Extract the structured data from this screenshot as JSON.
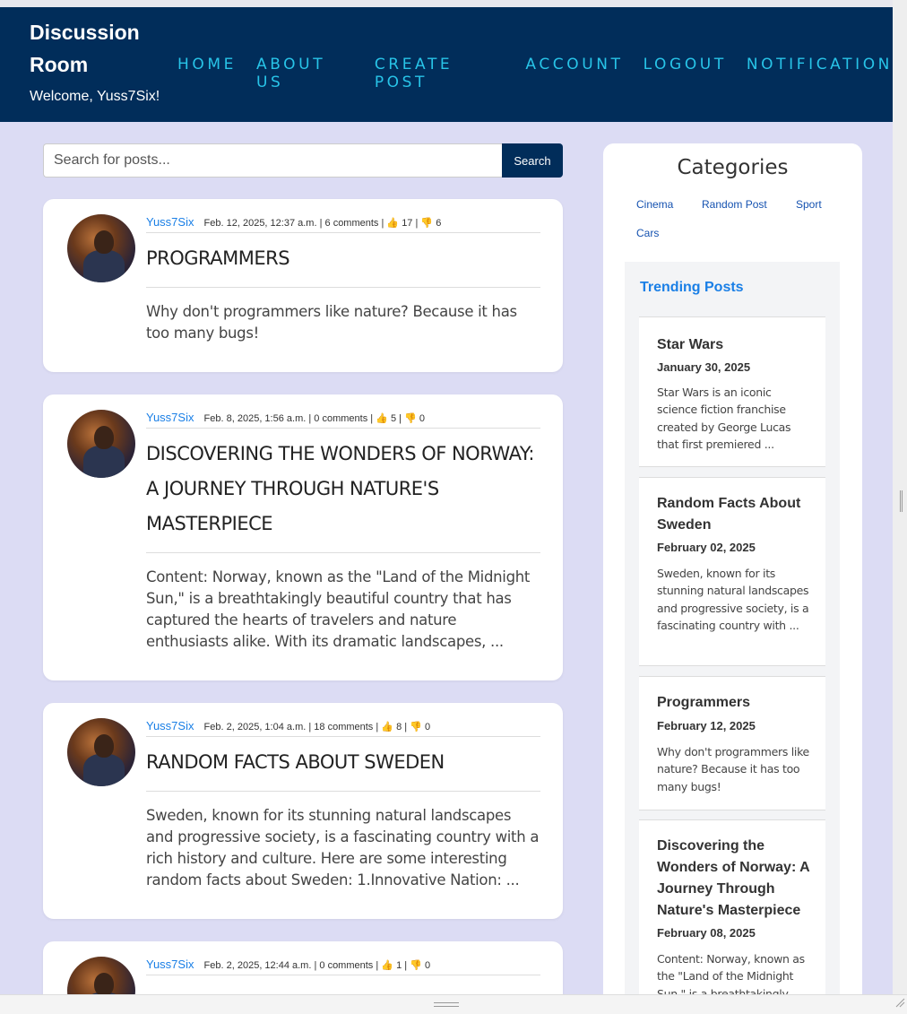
{
  "brand": {
    "line1": "Discussion",
    "line2": "Room",
    "welcome": "Welcome, Yuss7Six!"
  },
  "nav": [
    "HOME",
    "ABOUT US",
    "CREATE POST",
    "ACCOUNT",
    "LOGOUT",
    "NOTIFICATION"
  ],
  "search": {
    "placeholder": "Search for posts...",
    "value": "",
    "button": "Search"
  },
  "posts": [
    {
      "author": "Yuss7Six",
      "date": "Feb. 12, 2025, 12:37 a.m.",
      "comments": "6 comments",
      "likes": "17",
      "dislikes": "6",
      "title": "PROGRAMMERS",
      "excerpt": "Why don't programmers like nature? Because it has too many bugs!"
    },
    {
      "author": "Yuss7Six",
      "date": "Feb. 8, 2025, 1:56 a.m.",
      "comments": "0 comments",
      "likes": "5",
      "dislikes": "0",
      "title": "DISCOVERING THE WONDERS OF NORWAY: A JOURNEY THROUGH NATURE'S MASTERPIECE",
      "excerpt": "Content: Norway, known as the \"Land of the Midnight Sun,\" is a breathtakingly beautiful country that has captured the hearts of travelers and nature enthusiasts alike. With its dramatic landscapes, ..."
    },
    {
      "author": "Yuss7Six",
      "date": "Feb. 2, 2025, 1:04 a.m.",
      "comments": "18 comments",
      "likes": "8",
      "dislikes": "0",
      "title": "RANDOM FACTS ABOUT SWEDEN",
      "excerpt": "Sweden, known for its stunning natural landscapes and progressive society, is a fascinating country with a rich history and culture. Here are some interesting random facts about Sweden: 1.Innovative Nation: ..."
    },
    {
      "author": "Yuss7Six",
      "date": "Feb. 2, 2025, 12:44 a.m.",
      "comments": "0 comments",
      "likes": "1",
      "dislikes": "0",
      "title": "",
      "excerpt": ""
    }
  ],
  "sidebar": {
    "categories_title": "Categories",
    "categories": [
      "Cinema",
      "Random Post",
      "Sport",
      "Cars"
    ],
    "trending_title": "Trending Posts",
    "trending": [
      {
        "title": "Star Wars",
        "date": "January 30, 2025",
        "excerpt": "Star Wars is an iconic science fiction franchise created by George Lucas that first premiered ..."
      },
      {
        "title": "Random Facts About Sweden",
        "date": "February 02, 2025",
        "excerpt": "Sweden, known for its stunning natural landscapes and progressive society, is a fascinating country with ..."
      },
      {
        "title": "Programmers",
        "date": "February 12, 2025",
        "excerpt": "Why don't programmers like nature? Because it has too many bugs!"
      },
      {
        "title": "Discovering the Wonders of Norway: A Journey Through Nature's Masterpiece",
        "date": "February 08, 2025",
        "excerpt": "Content: Norway, known as the \"Land of the Midnight Sun,\" is a breathtakingly ..."
      }
    ]
  },
  "icons": {
    "like": "thumbs-up-icon",
    "dislike": "thumbs-down-icon"
  },
  "colors": {
    "header": "#012d5a",
    "nav": "#28c4e8",
    "link": "#1a7fe6",
    "background": "#dcdcf4"
  }
}
